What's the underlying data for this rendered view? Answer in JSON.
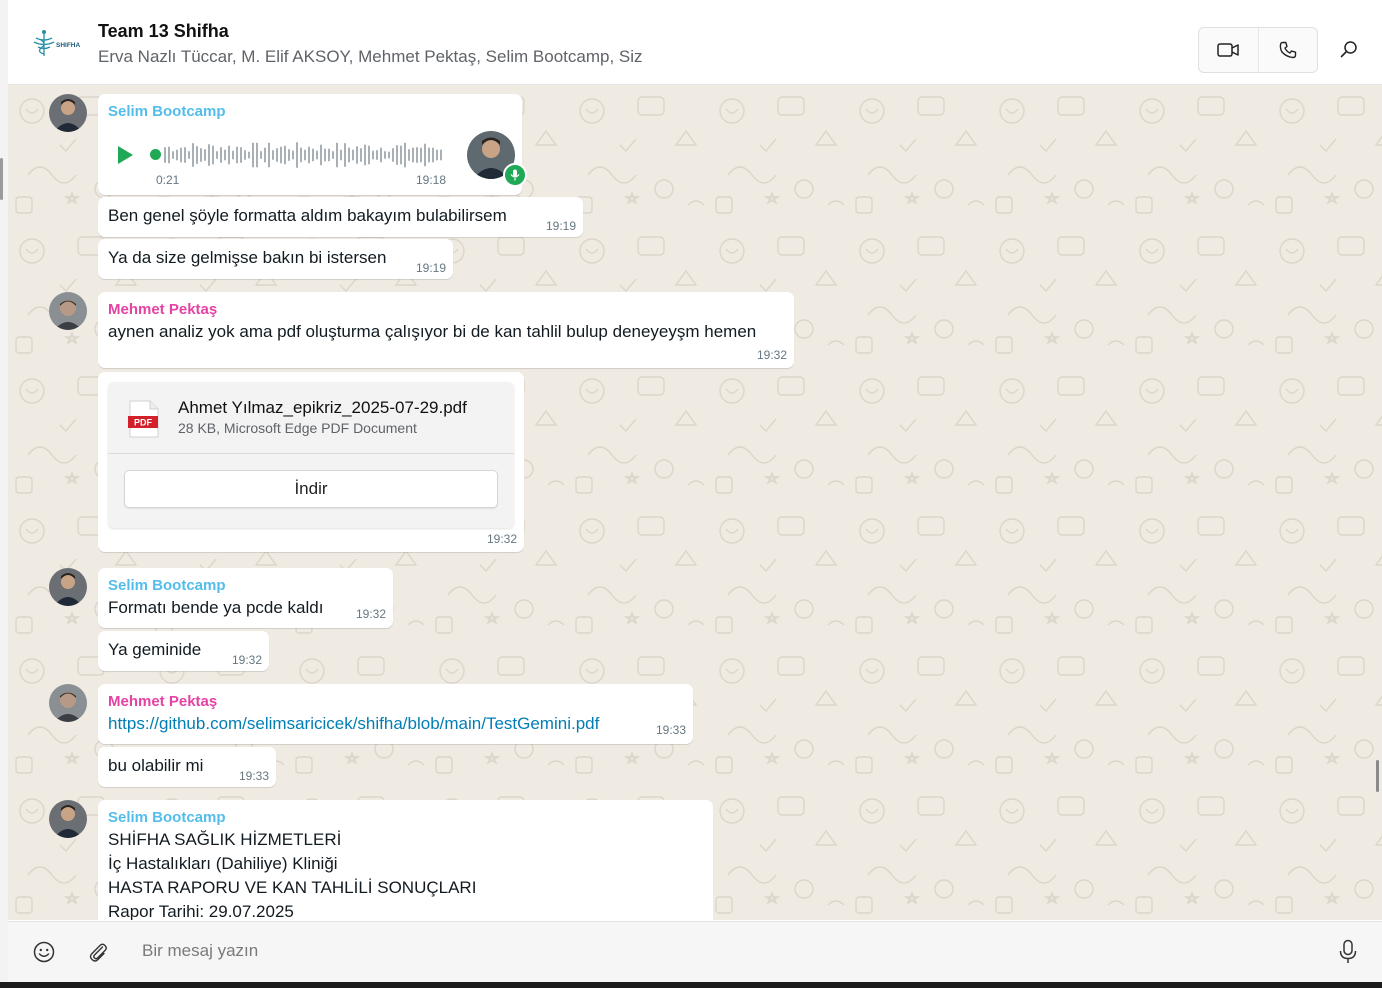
{
  "header": {
    "title": "Team 13 Shifha",
    "members": "Erva Nazlı Tüccar, M. Elif AKSOY, Mehmet Pektaş, Selim Bootcamp, Siz",
    "logo_text": "SHIFHA"
  },
  "colors": {
    "selim": "#53bdeb",
    "mehmet": "#e542a3",
    "accent_green": "#1fa855",
    "link": "#027eb5",
    "wallpaper": "#efeae2"
  },
  "messages": {
    "m1": {
      "sender": "Selim Bootcamp",
      "type": "voice",
      "duration": "0:21",
      "time": "19:18"
    },
    "m2": {
      "text": "Ben genel şöyle formatta aldım bakayım bulabilirsem",
      "time": "19:19"
    },
    "m3": {
      "text": "Ya da size gelmişse bakın bi istersen",
      "time": "19:19"
    },
    "m4": {
      "sender": "Mehmet Pektaş",
      "text": "aynen analiz yok ama pdf oluşturma çalışıyor bi de kan tahlil bulup deneyeyşm hemen",
      "time": "19:32"
    },
    "m5": {
      "type": "document",
      "icon_label": "PDF",
      "file_name": "Ahmet Yılmaz_epikriz_2025-07-29.pdf",
      "file_meta": "28 KB, Microsoft Edge PDF Document",
      "download_label": "İndir",
      "time": "19:32"
    },
    "m6": {
      "sender": "Selim Bootcamp",
      "text": "Formatı bende ya pcde kaldı",
      "time": "19:32"
    },
    "m7": {
      "text": "Ya geminide",
      "time": "19:32"
    },
    "m8": {
      "sender": "Mehmet Pektaş",
      "text": "https://github.com/selimsaricicek/shifha/blob/main/TestGemini.pdf",
      "time": "19:33"
    },
    "m9": {
      "text": "bu olabilir mi",
      "time": "19:33"
    },
    "m10": {
      "sender": "Selim Bootcamp",
      "lines": [
        "SHİFHA SAĞLIK HİZMETLERİ",
        "İç Hastalıkları (Dahiliye) Kliniği",
        "HASTA RAPORU VE KAN TAHLİLİ SONUÇLARI",
        "Rapor Tarihi: 29.07.2025"
      ]
    }
  },
  "composer": {
    "placeholder": "Bir mesaj yazın",
    "value": ""
  },
  "icons": [
    "video-call-icon",
    "voice-call-icon",
    "search-icon",
    "play-icon",
    "mic-icon",
    "pdf-icon",
    "emoji-icon",
    "attach-icon",
    "arrow-down-icon"
  ]
}
